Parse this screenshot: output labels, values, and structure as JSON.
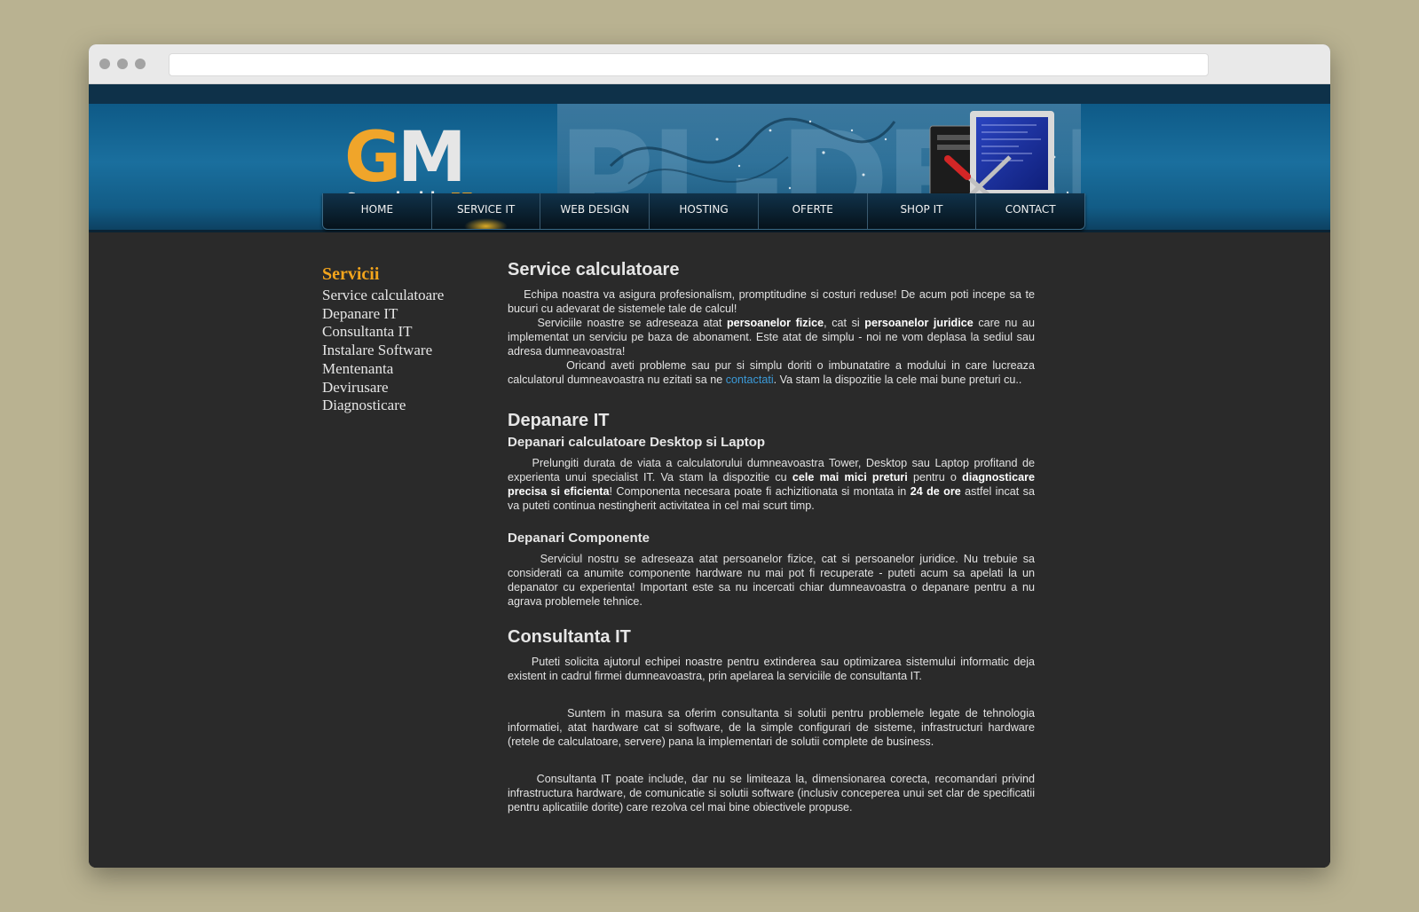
{
  "browser": {
    "url": ""
  },
  "logo": {
    "letters_g": "G",
    "letters_m": "M",
    "sub_text": "Servicii ",
    "sub_accent": "IT"
  },
  "nav": {
    "items": [
      {
        "label": "HOME"
      },
      {
        "label": "SERVICE IT",
        "active": true
      },
      {
        "label": "WEB DESIGN"
      },
      {
        "label": "HOSTING"
      },
      {
        "label": "OFERTE"
      },
      {
        "label": "SHOP IT"
      },
      {
        "label": "CONTACT"
      }
    ]
  },
  "sidebar": {
    "title": "Servicii",
    "items": [
      "Service calculatoare",
      "Depanare IT",
      "Consultanta IT",
      "Instalare Software",
      "Mentenanta",
      "Devirusare",
      "Diagnosticare"
    ]
  },
  "colors": {
    "accent": "#f2a41c",
    "link": "#3b9ad8",
    "background": "#2a2a2a",
    "header_blue": "#1a6f9e"
  },
  "main": {
    "s1": {
      "title": "Service calculatoare",
      "p1": "Echipa noastra va asigura profesionalism, promptitudine si costuri reduse! De acum poti incepe sa te bucuri cu adevarat de sistemele tale de calcul!",
      "p2a": "Serviciile noastre se adreseaza atat ",
      "p2b": "persoanelor fizice",
      "p2c": ", cat si ",
      "p2d": "persoanelor juridice",
      "p2e": " care nu au implementat un serviciu pe baza de abonament. Este atat de simplu - noi ne vom deplasa la sediul sau adresa dumneavoastra!",
      "p3a": "Oricand aveti probleme sau pur si simplu doriti o imbunatatire a modului in care lucreaza calculatorul dumneavoastra nu ezitati sa ne ",
      "p3link": "contactati",
      "p3b": ". Va stam la dispozitie la cele mai bune preturi cu.."
    },
    "s2": {
      "title": "Depanare IT",
      "sub1": "Depanari calculatoare Desktop si Laptop",
      "p1a": "Prelungiti durata de viata a calculatorului dumneavoastra Tower, Desktop sau Laptop profitand de experienta unui specialist IT. Va stam la dispozitie cu ",
      "p1b": "cele mai mici preturi",
      "p1c": " pentru o ",
      "p1d": "diagnosticare precisa si eficienta",
      "p1e": "! Componenta necesara poate fi achizitionata si montata in ",
      "p1f": "24 de ore",
      "p1g": " astfel incat sa va puteti continua nestingherit activitatea in cel mai scurt timp.",
      "sub2": "Depanari Componente",
      "p2": "Serviciul nostru se adreseaza atat persoanelor fizice, cat si persoanelor juridice. Nu trebuie sa considerati ca anumite componente hardware nu mai pot fi recuperate - puteti acum sa apelati la un depanator cu experienta! Important este sa nu incercati chiar dumneavoastra o depanare pentru a nu agrava problemele tehnice."
    },
    "s3": {
      "title": "Consultanta IT",
      "p1": "Puteti solicita ajutorul echipei noastre pentru extinderea sau optimizarea sistemului informatic deja existent in cadrul firmei dumneavoastra, prin apelarea la serviciile de consultanta IT.",
      "p2": "Suntem in masura sa oferim consultanta si solutii pentru problemele legate de tehnologia informatiei, atat hardware cat si software, de la simple configurari de sisteme, infrastructuri hardware (retele de calculatoare, servere) pana la implementari de solutii complete de business.",
      "p3": "Consultanta IT poate include, dar nu se limiteaza la, dimensionarea corecta, recomandari privind infrastructura hardware, de comunicatie si solutii software (inclusiv conceperea unui set clar de specificatii pentru aplicatiile dorite) care rezolva cel mai bine obiectivele propuse."
    }
  }
}
